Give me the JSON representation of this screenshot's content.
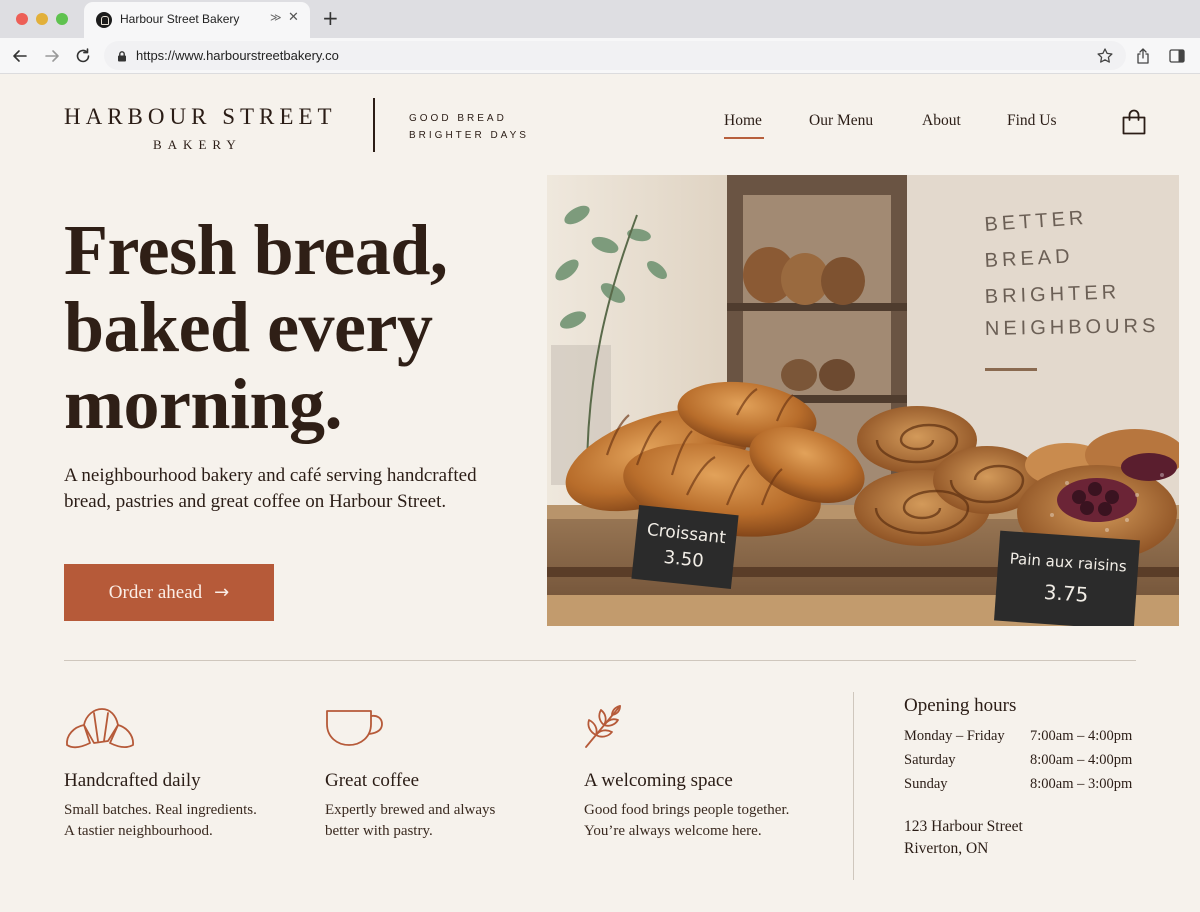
{
  "browser": {
    "tab_title": "Harbour Street Bakery",
    "new_tab_label": "+",
    "close_label": "✕",
    "url": "https://www.harbourstreetbakery.co"
  },
  "site": {
    "logo_main": "HARBOUR STREET",
    "logo_sub": "BAKERY",
    "tagline_1": "GOOD BREAD",
    "tagline_2": "BRIGHTER DAYS",
    "nav": [
      "Home",
      "Our Menu",
      "About",
      "Find Us"
    ],
    "active_nav": "Home"
  },
  "hero": {
    "title_1": "Fresh bread,",
    "title_2": "baked every",
    "title_3": "morning.",
    "subtitle": "A neighbourhood bakery and café serving handcrafted bread, pastries and great coffee on Harbour Street.",
    "cta_label": "Order ahead",
    "image": {
      "wall_sign": [
        "BETTER",
        "BREAD",
        "BRIGHTER",
        "NEIGHBOURS"
      ],
      "label_croissant_name": "Croissant",
      "label_croissant_price": "3.50",
      "label_raisin_name": "Pain aux raisins",
      "label_raisin_price": "3.75"
    }
  },
  "features": [
    {
      "icon": "croissant-icon",
      "title": "Handcrafted daily",
      "line1": "Small batches. Real ingredients.",
      "line2": "A tastier neighbourhood."
    },
    {
      "icon": "coffee-cup-icon",
      "title": "Great coffee",
      "line1": "Expertly brewed and always",
      "line2": "better with pastry."
    },
    {
      "icon": "wheat-icon",
      "title": "A welcoming space",
      "line1": "Good food brings people together.",
      "line2": "You’re always welcome here."
    }
  ],
  "hours": {
    "title": "Opening hours",
    "rows": [
      {
        "day": "Monday – Friday",
        "time": "7:00am – 4:00pm"
      },
      {
        "day": "Saturday",
        "time": "8:00am – 4:00pm"
      },
      {
        "day": "Sunday",
        "time": "8:00am – 3:00pm"
      }
    ],
    "address_1": "123 Harbour Street",
    "address_2": "Riverton, ON"
  },
  "colors": {
    "accent": "#b65a39",
    "background": "#f6f2ec",
    "text": "#2b1d16"
  }
}
